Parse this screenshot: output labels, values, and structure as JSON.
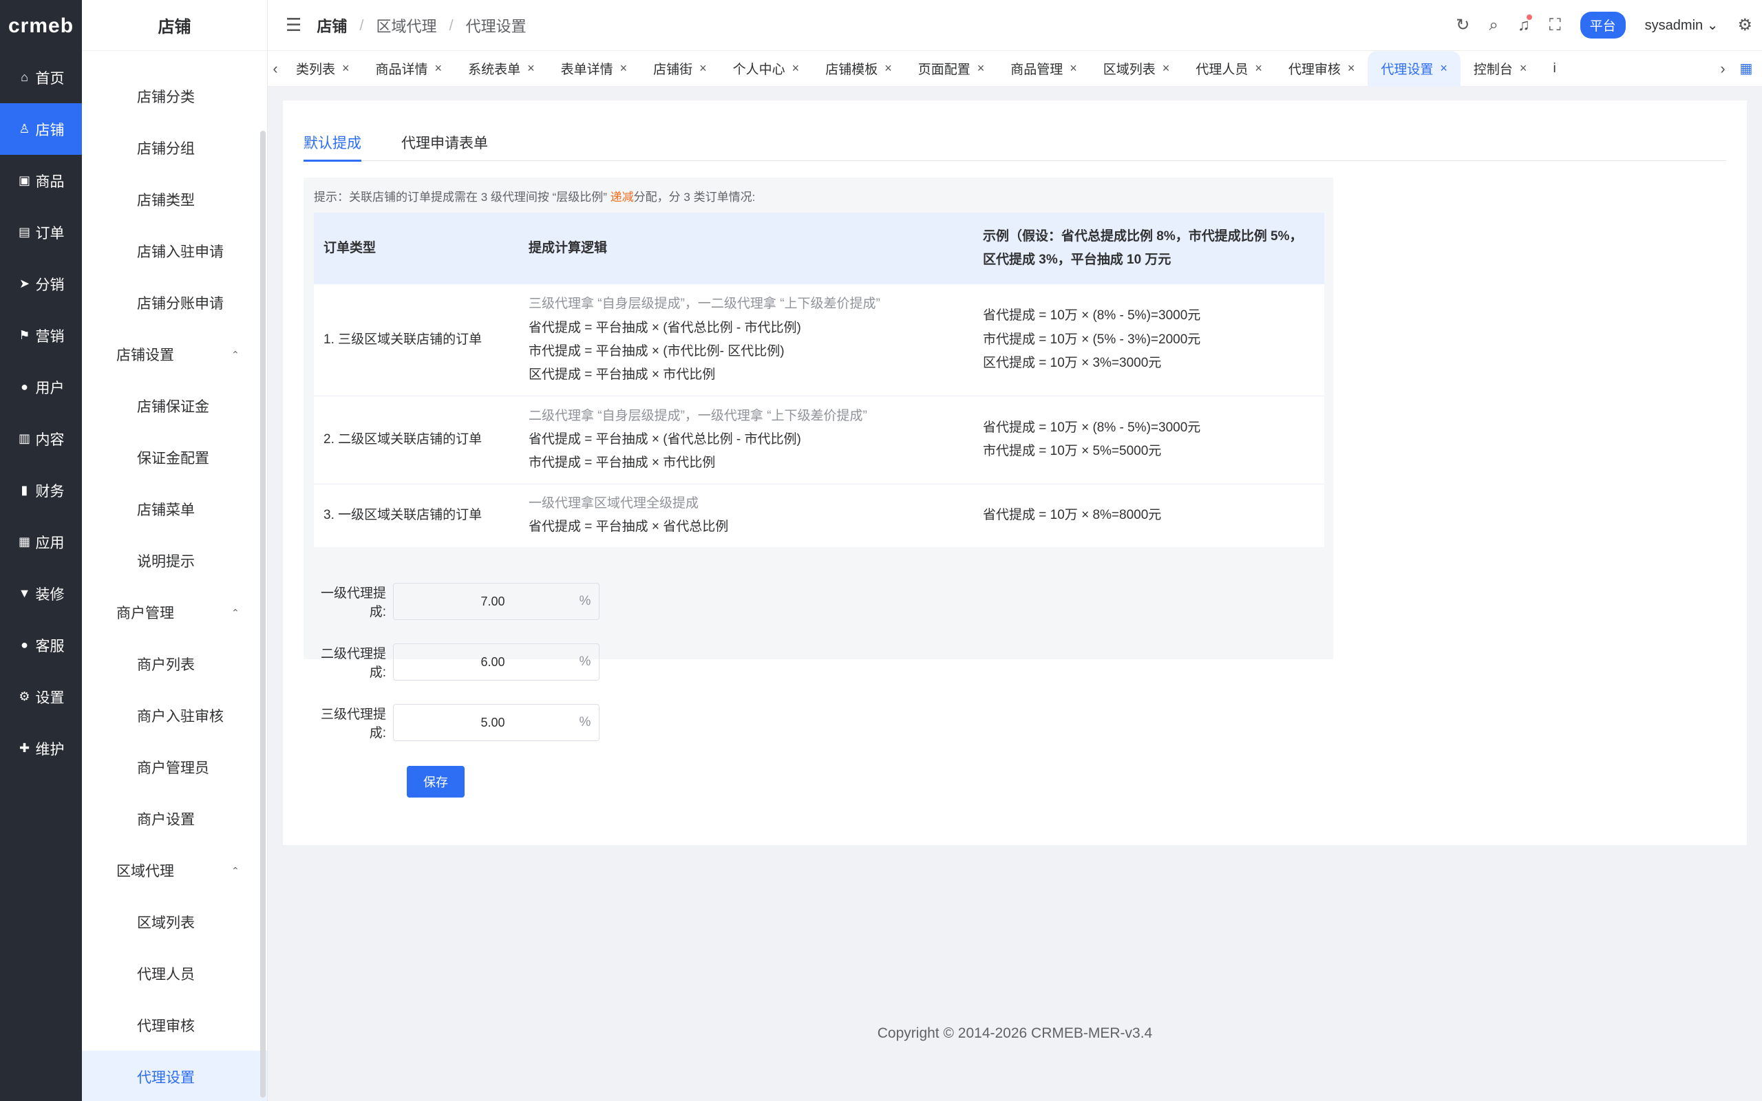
{
  "rail": {
    "logo": "crmeb",
    "items": [
      {
        "label": "首页",
        "icon": "home-icon",
        "glyph": "⌂"
      },
      {
        "label": "店铺",
        "icon": "user-icon",
        "glyph": "♙"
      },
      {
        "label": "商品",
        "icon": "bag-icon",
        "glyph": "▣"
      },
      {
        "label": "订单",
        "icon": "clipboard-icon",
        "glyph": "▤"
      },
      {
        "label": "分销",
        "icon": "send-icon",
        "glyph": "➤"
      },
      {
        "label": "营销",
        "icon": "flag-icon",
        "glyph": "⚑"
      },
      {
        "label": "用户",
        "icon": "person-icon",
        "glyph": "●"
      },
      {
        "label": "内容",
        "icon": "book-icon",
        "glyph": "▥"
      },
      {
        "label": "财务",
        "icon": "bar-chart-icon",
        "glyph": "▮"
      },
      {
        "label": "应用",
        "icon": "grid-icon",
        "glyph": "▦"
      },
      {
        "label": "装修",
        "icon": "brush-icon",
        "glyph": "▼"
      },
      {
        "label": "客服",
        "icon": "headset-icon",
        "glyph": "●"
      },
      {
        "label": "设置",
        "icon": "gear-icon",
        "glyph": "⚙"
      },
      {
        "label": "维护",
        "icon": "wrench-icon",
        "glyph": "✚"
      }
    ]
  },
  "menu": {
    "title": "店铺",
    "items": {
      "shop_category": "店铺分类",
      "shop_group": "店铺分组",
      "shop_type": "店铺类型",
      "shop_apply": "店铺入驻申请",
      "shop_split_apply": "店铺分账申请",
      "group_shop_settings": "店铺设置",
      "shop_deposit": "店铺保证金",
      "deposit_config": "保证金配置",
      "shop_menu": "店铺菜单",
      "notice": "说明提示",
      "group_merchant": "商户管理",
      "merchant_list": "商户列表",
      "merchant_audit": "商户入驻审核",
      "merchant_admin": "商户管理员",
      "merchant_settings": "商户设置",
      "group_agent": "区域代理",
      "region_list": "区域列表",
      "agent_staff": "代理人员",
      "agent_audit": "代理审核",
      "agent_settings": "代理设置"
    }
  },
  "header": {
    "breadcrumb": [
      "店铺",
      "区域代理",
      "代理设置"
    ],
    "platform": "平台",
    "user": "sysadmin"
  },
  "tabs": [
    "类列表",
    "商品详情",
    "系统表单",
    "表单详情",
    "店铺街",
    "个人中心",
    "店铺模板",
    "页面配置",
    "商品管理",
    "区域列表",
    "代理人员",
    "代理审核",
    "代理设置",
    "控制台"
  ],
  "tab_overflow": "i",
  "content": {
    "inner_tabs": [
      "默认提成",
      "代理申请表单"
    ],
    "tip_prefix": "提示：关联店铺的订单提成需在 3 级代理间按 “层级比例” ",
    "tip_highlight": "递减",
    "tip_suffix": "分配，分 3 类订单情况:",
    "table": {
      "headers": [
        "订单类型",
        "提成计算逻辑",
        "示例（假设：省代总提成比例 8%，市代提成比例 5%，区代提成 3%，平台抽成 10 万元"
      ],
      "rows": [
        {
          "type": "1. 三级区域关联店铺的订单",
          "logic_note": "三级代理拿 “自身层级提成”，一二级代理拿 “上下级差价提成”",
          "logic": [
            "省代提成 = 平台抽成 × (省代总比例 - 市代比例)",
            "市代提成 = 平台抽成 × (市代比例- 区代比例)",
            "区代提成 = 平台抽成 × 市代比例"
          ],
          "example": [
            "省代提成 = 10万 × (8% - 5%)=3000元",
            "市代提成 = 10万 × (5% - 3%)=2000元",
            "区代提成 = 10万 × 3%=3000元"
          ]
        },
        {
          "type": "2. 二级区域关联店铺的订单",
          "logic_note": "二级代理拿 “自身层级提成”，一级代理拿 “上下级差价提成”",
          "logic": [
            "省代提成 = 平台抽成 × (省代总比例 - 市代比例)",
            "市代提成 = 平台抽成 × 市代比例"
          ],
          "example": [
            "省代提成 = 10万 × (8% - 5%)=3000元",
            "市代提成 = 10万 × 5%=5000元"
          ]
        },
        {
          "type": "3. 一级区域关联店铺的订单",
          "logic_note": "一级代理拿区域代理全级提成",
          "logic": [
            "省代提成 = 平台抽成 × 省代总比例"
          ],
          "example": [
            "省代提成 = 10万 × 8%=8000元"
          ]
        }
      ]
    },
    "form": {
      "level1_label": "一级代理提成:",
      "level1_value": "7.00",
      "level2_label": "二级代理提成:",
      "level2_value": "6.00",
      "level3_label": "三级代理提成:",
      "level3_value": "5.00",
      "unit": "%",
      "save": "保存"
    }
  },
  "footer": {
    "copyright": "Copyright © 2014-2026 CRMEB-MER-v3.4"
  },
  "colors": {
    "primary": "#2d6ef5",
    "rail_bg": "#282c34",
    "highlight": "#f56c1c"
  }
}
